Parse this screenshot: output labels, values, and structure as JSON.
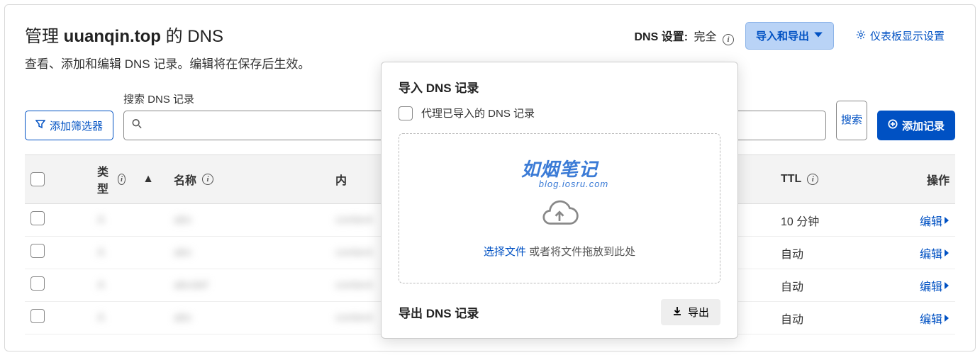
{
  "header": {
    "title_prefix": "管理 ",
    "domain": "uuanqin.top",
    "title_suffix": " 的 DNS",
    "subtitle": "查看、添加和编辑 DNS 记录。编辑将在保存后生效。",
    "dns_setting_label": "DNS 设置:",
    "dns_setting_value": "完全",
    "import_export_btn": "导入和导出",
    "dashboard_settings": "仪表板显示设置"
  },
  "search": {
    "add_filter": "添加筛选器",
    "label": "搜索 DNS 记录",
    "search_btn": "搜索",
    "add_record": "添加记录"
  },
  "table": {
    "headers": {
      "type": "类型",
      "name": "名称",
      "content": "内",
      "ttl": "TTL",
      "action": "操作"
    },
    "rows": [
      {
        "ttl": "10 分钟",
        "edit": "编辑"
      },
      {
        "ttl": "自动",
        "edit": "编辑"
      },
      {
        "ttl": "自动",
        "edit": "编辑"
      },
      {
        "ttl": "自动",
        "edit": "编辑"
      }
    ]
  },
  "popup": {
    "import_title": "导入 DNS 记录",
    "proxy_checkbox": "代理已导入的 DNS 记录",
    "watermark": "如烟笔记",
    "watermark_sub": "blog.iosru.com",
    "select_file": "选择文件",
    "drop_suffix": " 或者将文件拖放到此处",
    "export_title": "导出 DNS 记录",
    "export_btn": "导出"
  }
}
